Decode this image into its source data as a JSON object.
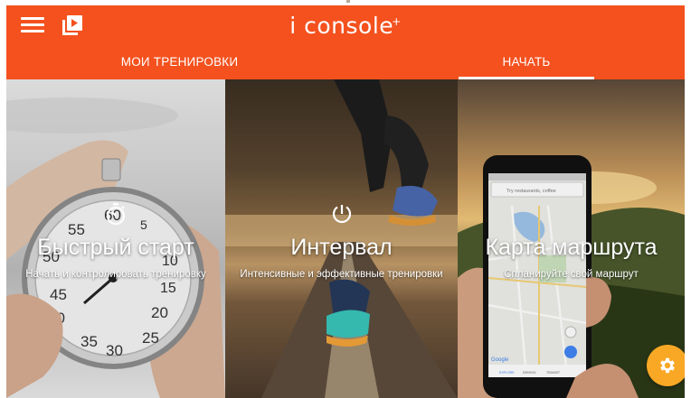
{
  "toolbar": {
    "brand": "i console",
    "brand_mark": "+",
    "menu_icon": "hamburger-menu-icon",
    "video_icon": "video-library-icon",
    "color": "#f4511e"
  },
  "tabs": [
    {
      "label": "МОИ ТРЕНИРОВКИ",
      "active": false
    },
    {
      "label": "НАЧАТЬ",
      "active": true
    }
  ],
  "cards": [
    {
      "title": "Быстрый старт",
      "subtitle": "Начать и контролировать тренировку",
      "icon": "stopwatch-icon"
    },
    {
      "title": "Интервал",
      "subtitle": "Интенсивные и эффективные тренировки",
      "icon": "timer-power-icon"
    },
    {
      "title": "Карта маршрута",
      "subtitle": "Спланируйте свой маршрут",
      "icon": "map-route-icon"
    }
  ],
  "stopwatch_dial": [
    "60",
    "5",
    "55",
    "50",
    "45",
    "40",
    "35",
    "30",
    "25",
    "20",
    "10",
    "15"
  ],
  "phone_map": {
    "search_placeholder": "Try restaurants, coffee",
    "bottom_tabs": [
      "EXPLORE",
      "DRIVING",
      "TRANSIT"
    ],
    "logo": "Google"
  },
  "fab": {
    "icon": "gear-icon",
    "color": "#f9a825"
  }
}
